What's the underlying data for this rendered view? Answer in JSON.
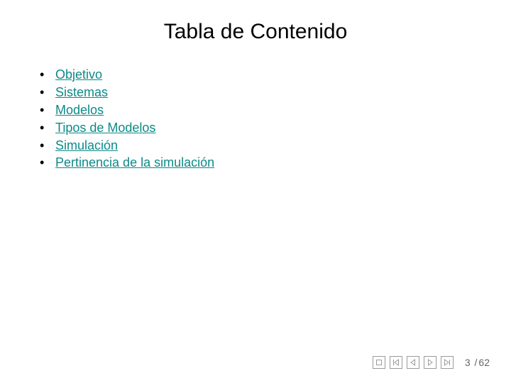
{
  "title": "Tabla de Contenido",
  "toc": {
    "items": [
      {
        "label": "Objetivo"
      },
      {
        "label": "Sistemas"
      },
      {
        "label": "Modelos"
      },
      {
        "label": "Tipos de Modelos"
      },
      {
        "label": "Simulación"
      },
      {
        "label": "Pertinencia de la simulación"
      }
    ]
  },
  "nav": {
    "icons": {
      "stop": "stop-icon",
      "first": "first-icon",
      "prev": "prev-icon",
      "next": "next-icon",
      "last": "last-icon"
    },
    "page": {
      "current": "3",
      "separator": "/",
      "total": "62"
    }
  }
}
